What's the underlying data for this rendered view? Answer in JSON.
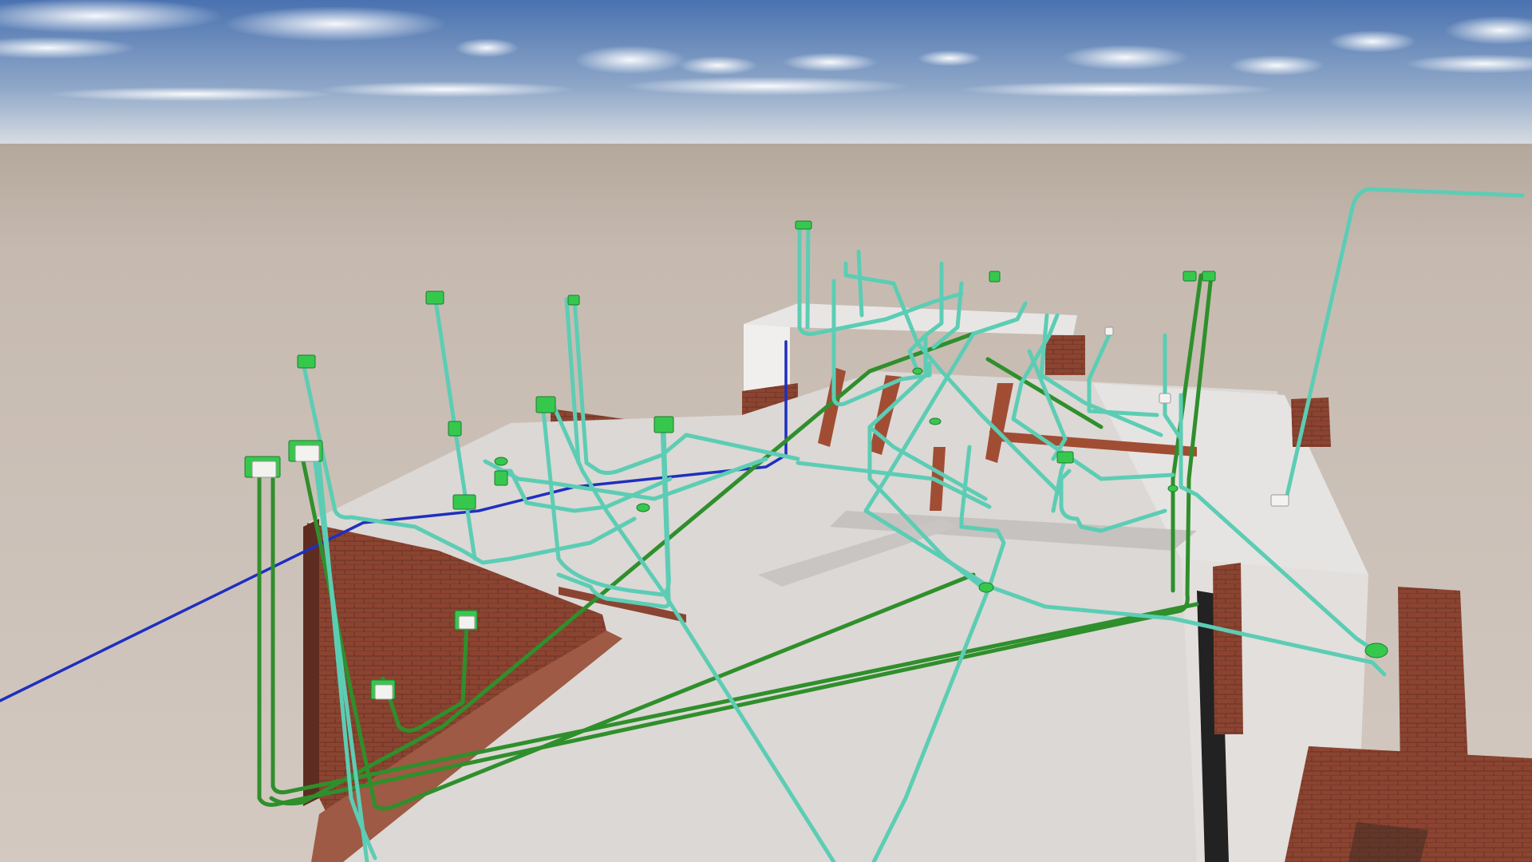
{
  "scene": {
    "kind": "3D render of electrical conduit layout over a building slab",
    "colors": {
      "sky_top": "#4f78b4",
      "sky_horizon": "#d7dde4",
      "ground_far": "#c1b5ab",
      "ground_near": "#d2c7bf",
      "slab": "#dedbd8",
      "slab_shadow": "#b9b5b1",
      "brick": "#8a4532",
      "brick_dark": "#5e2c20",
      "conduit_teal": "#5ccdb4",
      "conduit_green": "#2f8f2c",
      "conduit_blue": "#1f2fbf",
      "box_green": "#36c84d"
    }
  }
}
